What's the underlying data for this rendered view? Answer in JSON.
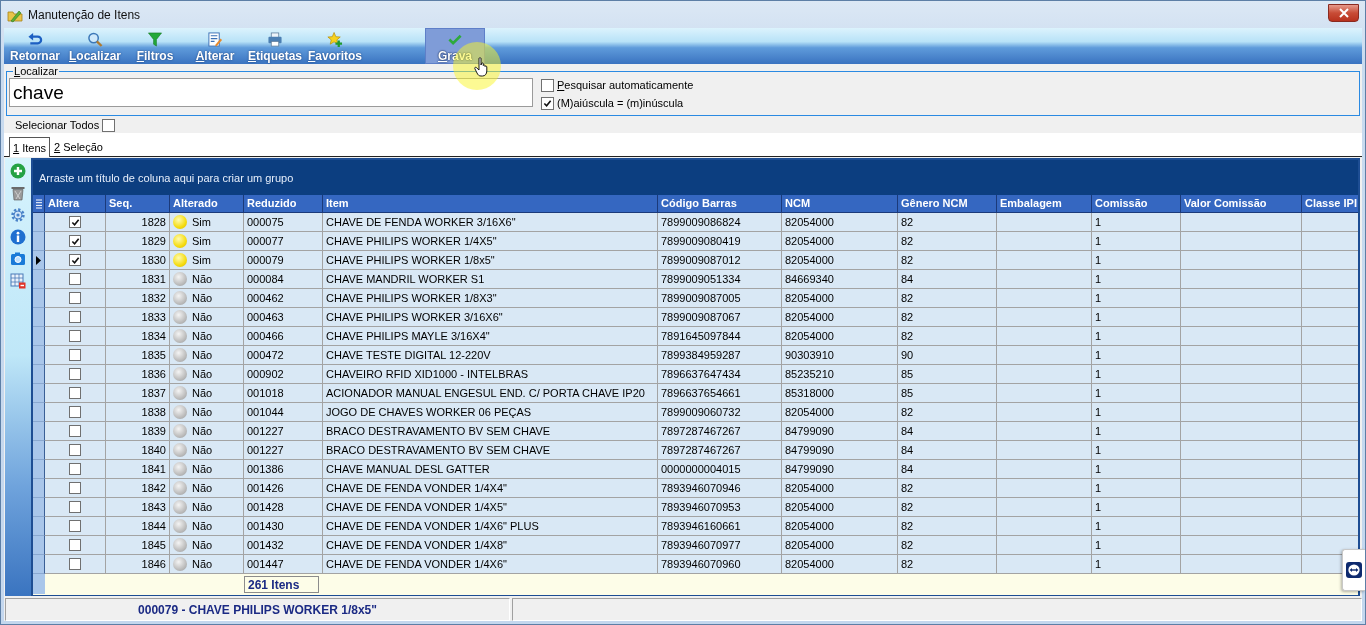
{
  "window": {
    "title": "Manutenção de Itens"
  },
  "toolbar": [
    {
      "label": "Retornar",
      "access_key": false,
      "highlighted": false
    },
    {
      "label": "Localizar",
      "access_key": true,
      "highlighted": false
    },
    {
      "label": "Filtros",
      "access_key": true,
      "highlighted": false
    },
    {
      "label": "Alterar",
      "access_key": true,
      "highlighted": false
    },
    {
      "label": "Etiquetas",
      "access_key": true,
      "highlighted": false
    },
    {
      "label": "Favoritos",
      "access_key": true,
      "highlighted": false
    },
    {
      "label": "Grava",
      "access_key": true,
      "highlighted": true
    }
  ],
  "search": {
    "legend": "Localizar",
    "value": "chave",
    "options": [
      {
        "label": "Pesquisar automaticamente",
        "access_key": true,
        "checked": false
      },
      {
        "label": "(M)aiúscula = (m)inúscula",
        "access_key": false,
        "checked": true
      }
    ]
  },
  "select_all": {
    "label": "Selecionar Todos",
    "checked": false
  },
  "tabs": [
    {
      "label": "1 Itens",
      "selected": true
    },
    {
      "label": "2 Seleção",
      "selected": false
    }
  ],
  "grid": {
    "group_hint": "Arraste um título de coluna aqui para criar um grupo",
    "columns": [
      "Altera",
      "Seq.",
      "Alterado",
      "Reduzido",
      "Item",
      "Código Barras",
      "NCM",
      "Gênero NCM",
      "Embalagem",
      "Comissão",
      "Valor Comissão",
      "Classe IPI"
    ],
    "rows": [
      {
        "current": false,
        "altera": true,
        "seq": "1828",
        "changed": true,
        "alterado": "Sim",
        "reduzido": "000075",
        "item": "CHAVE DE FENDA WORKER 3/16X6\"",
        "codigo_barras": "7899009086824",
        "ncm": "82054000",
        "genero_ncm": "82",
        "comissao": "1"
      },
      {
        "current": false,
        "altera": true,
        "seq": "1829",
        "changed": true,
        "alterado": "Sim",
        "reduzido": "000077",
        "item": "CHAVE PHILIPS WORKER 1/4X5\"",
        "codigo_barras": "7899009080419",
        "ncm": "82054000",
        "genero_ncm": "82",
        "comissao": "1"
      },
      {
        "current": true,
        "altera": true,
        "seq": "1830",
        "changed": true,
        "alterado": "Sim",
        "reduzido": "000079",
        "item": "CHAVE PHILIPS WORKER 1/8x5\"",
        "codigo_barras": "7899009087012",
        "ncm": "82054000",
        "genero_ncm": "82",
        "comissao": "1"
      },
      {
        "current": false,
        "altera": false,
        "seq": "1831",
        "changed": false,
        "alterado": "Não",
        "reduzido": "000084",
        "item": "CHAVE MANDRIL WORKER S1",
        "codigo_barras": "7899009051334",
        "ncm": "84669340",
        "genero_ncm": "84",
        "comissao": "1"
      },
      {
        "current": false,
        "altera": false,
        "seq": "1832",
        "changed": false,
        "alterado": "Não",
        "reduzido": "000462",
        "item": "CHAVE PHILIPS WORKER 1/8X3\"",
        "codigo_barras": "7899009087005",
        "ncm": "82054000",
        "genero_ncm": "82",
        "comissao": "1"
      },
      {
        "current": false,
        "altera": false,
        "seq": "1833",
        "changed": false,
        "alterado": "Não",
        "reduzido": "000463",
        "item": "CHAVE PHILIPS WORKER 3/16X6\"",
        "codigo_barras": "7899009087067",
        "ncm": "82054000",
        "genero_ncm": "82",
        "comissao": "1"
      },
      {
        "current": false,
        "altera": false,
        "seq": "1834",
        "changed": false,
        "alterado": "Não",
        "reduzido": "000466",
        "item": "CHAVE PHILIPS MAYLE 3/16X4\"",
        "codigo_barras": "7891645097844",
        "ncm": "82054000",
        "genero_ncm": "82",
        "comissao": "1"
      },
      {
        "current": false,
        "altera": false,
        "seq": "1835",
        "changed": false,
        "alterado": "Não",
        "reduzido": "000472",
        "item": "CHAVE TESTE DIGITAL 12-220V",
        "codigo_barras": "7899384959287",
        "ncm": "90303910",
        "genero_ncm": "90",
        "comissao": "1"
      },
      {
        "current": false,
        "altera": false,
        "seq": "1836",
        "changed": false,
        "alterado": "Não",
        "reduzido": "000902",
        "item": "CHAVEIRO RFID XID1000 - INTELBRAS",
        "codigo_barras": "7896637647434",
        "ncm": "85235210",
        "genero_ncm": "85",
        "comissao": "1"
      },
      {
        "current": false,
        "altera": false,
        "seq": "1837",
        "changed": false,
        "alterado": "Não",
        "reduzido": "001018",
        "item": "ACIONADOR MANUAL ENGESUL END. C/ PORTA CHAVE IP20",
        "codigo_barras": "7896637654661",
        "ncm": "85318000",
        "genero_ncm": "85",
        "comissao": "1"
      },
      {
        "current": false,
        "altera": false,
        "seq": "1838",
        "changed": false,
        "alterado": "Não",
        "reduzido": "001044",
        "item": "JOGO DE CHAVES WORKER 06 PEÇAS",
        "codigo_barras": "7899009060732",
        "ncm": "82054000",
        "genero_ncm": "82",
        "comissao": "1"
      },
      {
        "current": false,
        "altera": false,
        "seq": "1839",
        "changed": false,
        "alterado": "Não",
        "reduzido": "001227",
        "item": "BRACO DESTRAVAMENTO BV SEM CHAVE",
        "codigo_barras": "7897287467267",
        "ncm": "84799090",
        "genero_ncm": "84",
        "comissao": "1"
      },
      {
        "current": false,
        "altera": false,
        "seq": "1840",
        "changed": false,
        "alterado": "Não",
        "reduzido": "001227",
        "item": "BRACO DESTRAVAMENTO BV SEM CHAVE",
        "codigo_barras": "7897287467267",
        "ncm": "84799090",
        "genero_ncm": "84",
        "comissao": "1"
      },
      {
        "current": false,
        "altera": false,
        "seq": "1841",
        "changed": false,
        "alterado": "Não",
        "reduzido": "001386",
        "item": "CHAVE MANUAL DESL GATTER",
        "codigo_barras": "0000000004015",
        "ncm": "84799090",
        "genero_ncm": "84",
        "comissao": "1"
      },
      {
        "current": false,
        "altera": false,
        "seq": "1842",
        "changed": false,
        "alterado": "Não",
        "reduzido": "001426",
        "item": "CHAVE DE FENDA VONDER 1/4X4\"",
        "codigo_barras": "7893946070946",
        "ncm": "82054000",
        "genero_ncm": "82",
        "comissao": "1"
      },
      {
        "current": false,
        "altera": false,
        "seq": "1843",
        "changed": false,
        "alterado": "Não",
        "reduzido": "001428",
        "item": "CHAVE DE FENDA VONDER 1/4X5\"",
        "codigo_barras": "7893946070953",
        "ncm": "82054000",
        "genero_ncm": "82",
        "comissao": "1"
      },
      {
        "current": false,
        "altera": false,
        "seq": "1844",
        "changed": false,
        "alterado": "Não",
        "reduzido": "001430",
        "item": "CHAVE DE FENDA VONDER 1/4X6\" PLUS",
        "codigo_barras": "7893946160661",
        "ncm": "82054000",
        "genero_ncm": "82",
        "comissao": "1"
      },
      {
        "current": false,
        "altera": false,
        "seq": "1845",
        "changed": false,
        "alterado": "Não",
        "reduzido": "001432",
        "item": "CHAVE DE FENDA VONDER 1/4X8\"",
        "codigo_barras": "7893946070977",
        "ncm": "82054000",
        "genero_ncm": "82",
        "comissao": "1"
      },
      {
        "current": false,
        "altera": false,
        "seq": "1846",
        "changed": false,
        "alterado": "Não",
        "reduzido": "001447",
        "item": "CHAVE DE FENDA VONDER 1/4X6\"",
        "codigo_barras": "7893946070960",
        "ncm": "82054000",
        "genero_ncm": "82",
        "comissao": "1"
      }
    ],
    "footer": {
      "count": "261 Itens"
    }
  },
  "status_bar": {
    "text": "000079 - CHAVE PHILIPS WORKER 1/8x5\""
  }
}
